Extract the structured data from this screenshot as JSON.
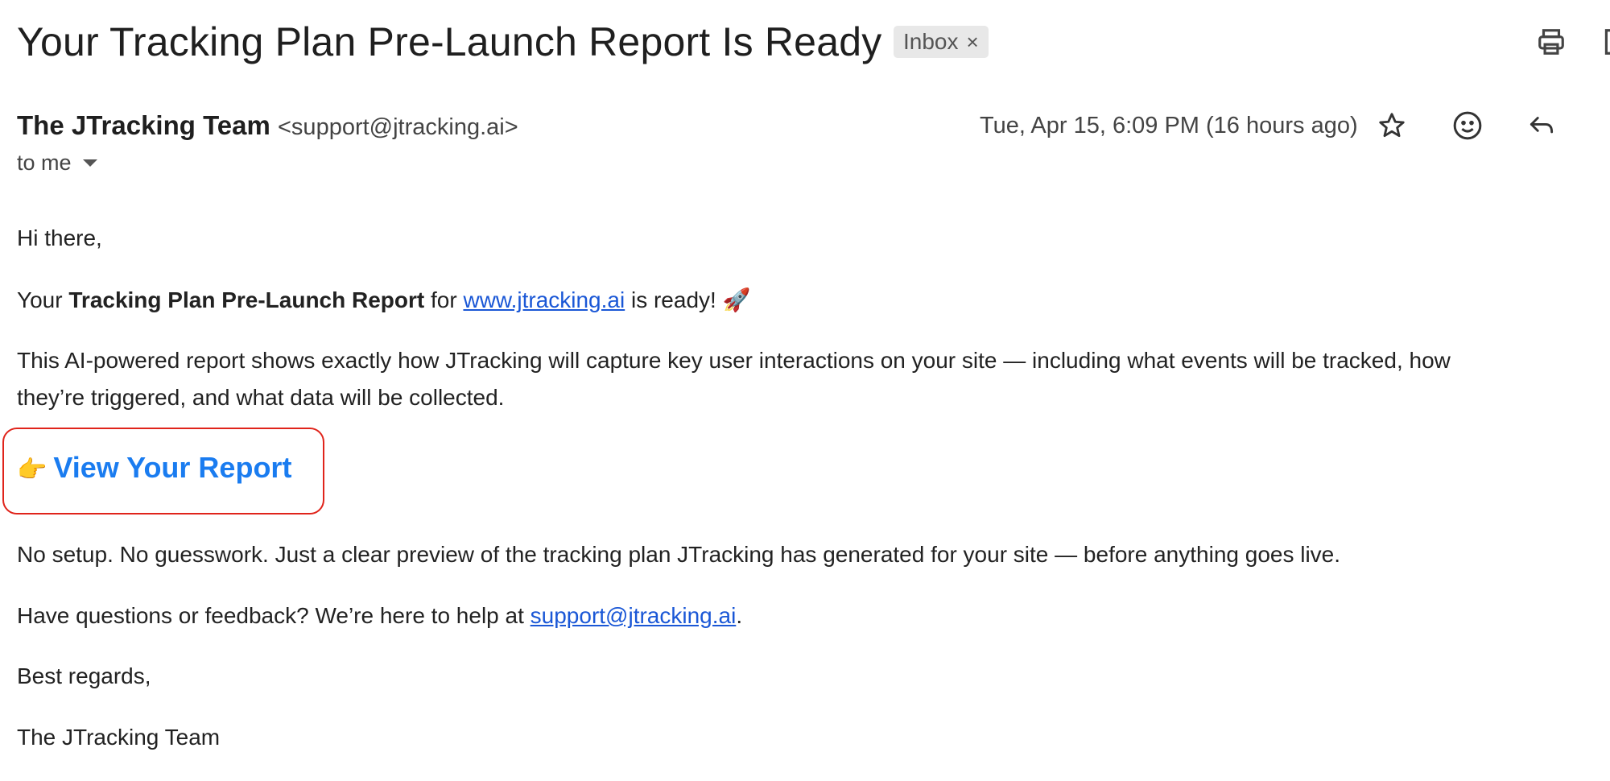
{
  "email": {
    "subject": "Your Tracking Plan Pre-Launch Report Is Ready",
    "label_chip": "Inbox",
    "label_chip_close": "×",
    "sender_name": "The JTracking Team",
    "sender_email": "<support@jtracking.ai>",
    "date": "Tue, Apr 15, 6:09 PM (16 hours ago)",
    "recipient": "to me"
  },
  "toolbar": {
    "icons": [
      "printer-icon",
      "open-in-new-icon",
      "star-icon",
      "emoji-icon",
      "reply-icon"
    ]
  },
  "body": {
    "greeting": "Hi there,",
    "line2_prefix": "Your ",
    "line2_bold": "Tracking Plan Pre-Launch Report",
    "line2_mid": " for ",
    "line2_link": "www.jtracking.ai",
    "line2_suffix": " is ready! 🚀",
    "para3_line1": "This AI-powered report shows exactly how JTracking will capture key user interactions on your site — including what events will be tracked, how",
    "para3_line2": "they’re triggered, and what data will be collected.",
    "cta_emoji": "👉",
    "cta_label": "View Your Report",
    "para5": "No setup. No guesswork. Just a clear preview of the tracking plan JTracking has generated for your site — before anything goes live.",
    "para6_prefix": "Have questions or feedback? We’re here to help at ",
    "para6_link": "support@jtracking.ai",
    "para6_suffix": ".",
    "signoff": "Best regards,",
    "signature": "The JTracking Team"
  },
  "colors": {
    "link": "#1a57d6",
    "cta": "#1a7cf0",
    "highlight_border": "#e0241b",
    "chip_bg": "#e8e8e8"
  }
}
